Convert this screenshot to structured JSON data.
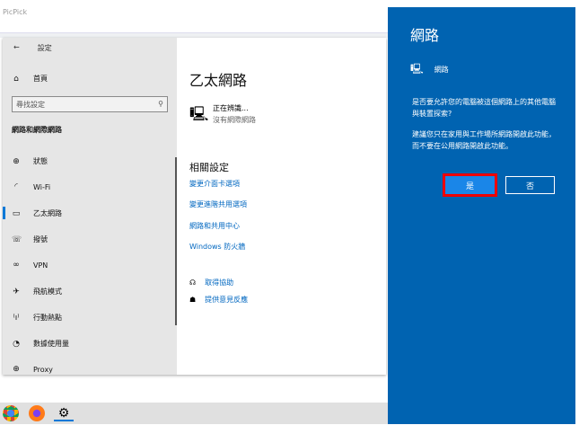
{
  "app_title": "PicPick",
  "settings": {
    "header": "設定",
    "home": "首頁",
    "search_placeholder": "尋找設定",
    "section": "網路和網際網路",
    "nav": [
      {
        "label": "狀態",
        "icon": "status-icon"
      },
      {
        "label": "Wi-Fi",
        "icon": "wifi-icon"
      },
      {
        "label": "乙太網路",
        "icon": "ethernet-icon",
        "selected": true
      },
      {
        "label": "撥號",
        "icon": "dialup-icon"
      },
      {
        "label": "VPN",
        "icon": "vpn-icon"
      },
      {
        "label": "飛航模式",
        "icon": "airplane-icon"
      },
      {
        "label": "行動熱點",
        "icon": "hotspot-icon"
      },
      {
        "label": "數據使用量",
        "icon": "data-usage-icon"
      },
      {
        "label": "Proxy",
        "icon": "globe-icon"
      }
    ],
    "main": {
      "title": "乙太網路",
      "status_line1": "正在辨識...",
      "status_line2": "沒有網際網路",
      "related_heading": "相關設定",
      "links": [
        "變更介面卡選項",
        "變更進階共用選項",
        "網路和共用中心",
        "Windows 防火牆"
      ],
      "help": "取得協助",
      "feedback": "提供意見反應"
    }
  },
  "panel": {
    "title": "網路",
    "network_name": "網路",
    "question": "是否要允許您的電腦被這個網路上的其他電腦與裝置探索?",
    "recommendation": "建議您只在家用與工作場所網路開啟此功能，而不要在公用網路開啟此功能。",
    "yes": "是",
    "no": "否"
  },
  "colors": {
    "panel": "#0063b1",
    "accent": "#0078d7",
    "highlight": "#e00000"
  }
}
